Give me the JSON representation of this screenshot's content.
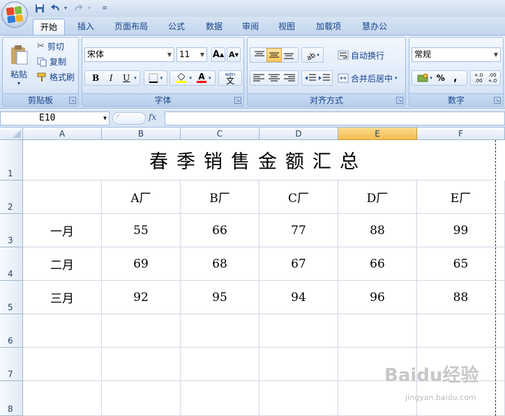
{
  "ribbon_tabs": [
    "开始",
    "插入",
    "页面布局",
    "公式",
    "数据",
    "审阅",
    "视图",
    "加载项",
    "慧办公"
  ],
  "clipboard": {
    "paste": "粘贴",
    "cut": "剪切",
    "copy": "复制",
    "format_painter": "格式刷",
    "group": "剪贴板"
  },
  "font": {
    "name": "宋体",
    "size": "11",
    "bold": "B",
    "italic": "I",
    "underline": "U",
    "font_color_letter": "A",
    "phonetic": "wén",
    "phonetic_char": "文",
    "grow": "A",
    "shrink": "A",
    "group": "字体"
  },
  "alignment": {
    "wrap": "自动换行",
    "merge": "合并后居中",
    "group": "对齐方式"
  },
  "number": {
    "format": "常规",
    "percent": "%",
    "comma": ",",
    "inc_decimal": "+.0\n.00",
    "dec_decimal": ".00\n+.0",
    "group": "数字"
  },
  "formula_bar": {
    "name_box": "E10",
    "fx": "fx",
    "content": ""
  },
  "columns": [
    "A",
    "B",
    "C",
    "D",
    "E",
    "F"
  ],
  "selected_column": "E",
  "rows": [
    "1",
    "2",
    "3",
    "4",
    "5",
    "6",
    "7",
    "8"
  ],
  "sheet": {
    "title": "春季销售金额汇总",
    "header": [
      "",
      "A厂",
      "B厂",
      "C厂",
      "D厂",
      "E厂"
    ],
    "data": [
      [
        "一月",
        "55",
        "66",
        "77",
        "88",
        "99"
      ],
      [
        "二月",
        "69",
        "68",
        "67",
        "66",
        "65"
      ],
      [
        "三月",
        "92",
        "95",
        "94",
        "96",
        "88"
      ]
    ]
  },
  "watermark": {
    "brand": "Baidu经验",
    "url": "jingyan.baidu.com"
  },
  "colors": {
    "accent": "#15428b",
    "selected_header": "#f6bb4e",
    "ribbon": "#dae6f5"
  }
}
